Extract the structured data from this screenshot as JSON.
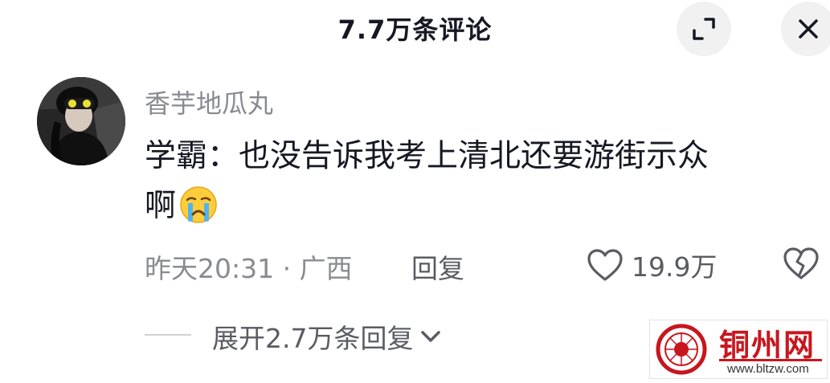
{
  "header": {
    "title": "7.7万条评论"
  },
  "comment": {
    "username": "香芋地瓜丸",
    "text_line1": "学霸：也没告诉我考上清北还要游街示众",
    "text_line2": "啊",
    "emoji": "crying-face",
    "time_location": "昨天20:31 · 广西",
    "reply_label": "回复",
    "like_count": "19.9万"
  },
  "replies": {
    "expand_label": "展开2.7万条回复"
  },
  "watermark": {
    "name": "铜州网",
    "url": "www.bltzw.com"
  },
  "colors": {
    "text": "#161823",
    "secondary": "#8a8b91",
    "watermark_red": "#c8161e"
  }
}
